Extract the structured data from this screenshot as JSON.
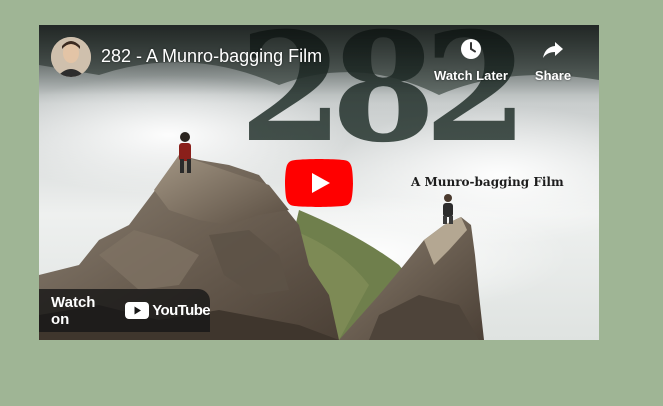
{
  "video": {
    "title": "282 - A Munro-bagging Film",
    "thumbnail_title_large": "282",
    "thumbnail_subtitle": "A Munro-bagging Film"
  },
  "actions": {
    "watch_later_label": "Watch Later",
    "share_label": "Share"
  },
  "watch_on": {
    "label": "Watch on",
    "brand": "YouTube"
  },
  "icons": {
    "avatar": "channel-avatar",
    "watch_later": "clock-icon",
    "share": "share-arrow-icon",
    "play": "play-icon",
    "logo": "youtube-logo-icon"
  },
  "colors": {
    "page_background": "#9fb595",
    "play_button_red": "#ff0000",
    "overlay_dark": "#171717"
  }
}
